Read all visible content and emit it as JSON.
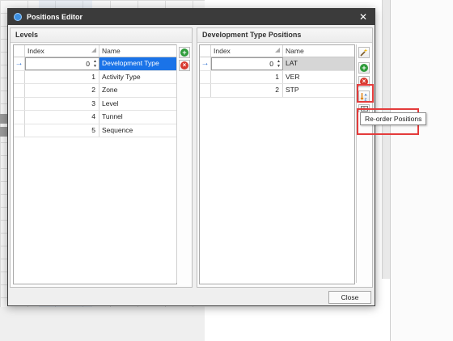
{
  "dialog": {
    "title": "Positions Editor",
    "close_glyph": "✕"
  },
  "levels": {
    "header": "Levels",
    "columns": {
      "index": "Index",
      "name": "Name"
    },
    "rows": [
      {
        "index": "0",
        "name": "Development Type"
      },
      {
        "index": "1",
        "name": "Activity Type"
      },
      {
        "index": "2",
        "name": "Zone"
      },
      {
        "index": "3",
        "name": "Level"
      },
      {
        "index": "4",
        "name": "Tunnel"
      },
      {
        "index": "5",
        "name": "Sequence"
      }
    ],
    "current_row_glyph": "→"
  },
  "positions": {
    "header": "Development Type Positions",
    "columns": {
      "index": "Index",
      "name": "Name"
    },
    "rows": [
      {
        "index": "0",
        "name": "LAT"
      },
      {
        "index": "1",
        "name": "VER"
      },
      {
        "index": "2",
        "name": "STP"
      }
    ],
    "current_row_glyph": "→"
  },
  "buttons": {
    "add_glyph": "+",
    "remove_glyph": "×",
    "close_label": "Close"
  },
  "tooltip": {
    "text": "Re-order Positions"
  },
  "icons": {
    "title": "app-logo-icon",
    "add": "add-icon",
    "remove": "remove-icon",
    "wand": "magic-wand-icon",
    "sort": "sort-az-icon",
    "table": "table-icon",
    "filter": "filter-icon"
  },
  "colors": {
    "selection": "#1a73e8",
    "add": "#2e9b3a",
    "remove": "#d83a2f",
    "highlight": "#e43b3b",
    "titlebar": "#3b3b3b"
  }
}
